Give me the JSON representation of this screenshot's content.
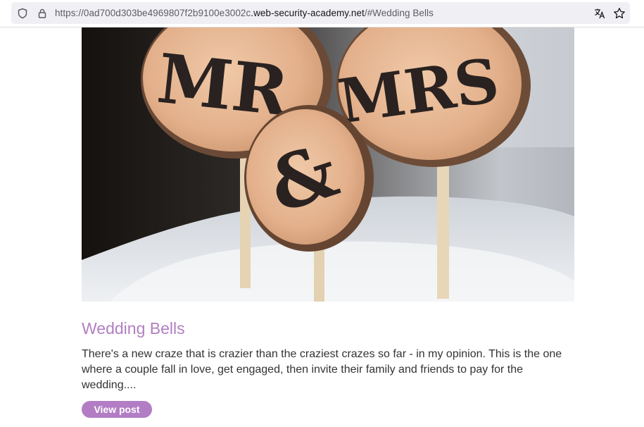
{
  "browser": {
    "url_prefix": "https://0ad700d303be4969807f2b9100e3002c",
    "url_domain": ".web-security-academy.net",
    "url_suffix": "/#Wedding Bells",
    "icons": [
      "shield-icon",
      "lock-icon",
      "translate-icon",
      "bookmark-star-icon"
    ]
  },
  "post": {
    "image_alt": "MR & MRS",
    "sign_left": "MR",
    "sign_middle": "&",
    "sign_right": "MRS",
    "title": "Wedding Bells",
    "summary": "There's a new craze that is crazier than the craziest crazes so far - in my opinion. This is the one where a couple fall in love, get engaged, then invite their family and friends to pay for the wedding....",
    "button_label": "View post"
  },
  "colors": {
    "title": "#b17fc2",
    "button": "#b27dc4",
    "text": "#333332"
  }
}
